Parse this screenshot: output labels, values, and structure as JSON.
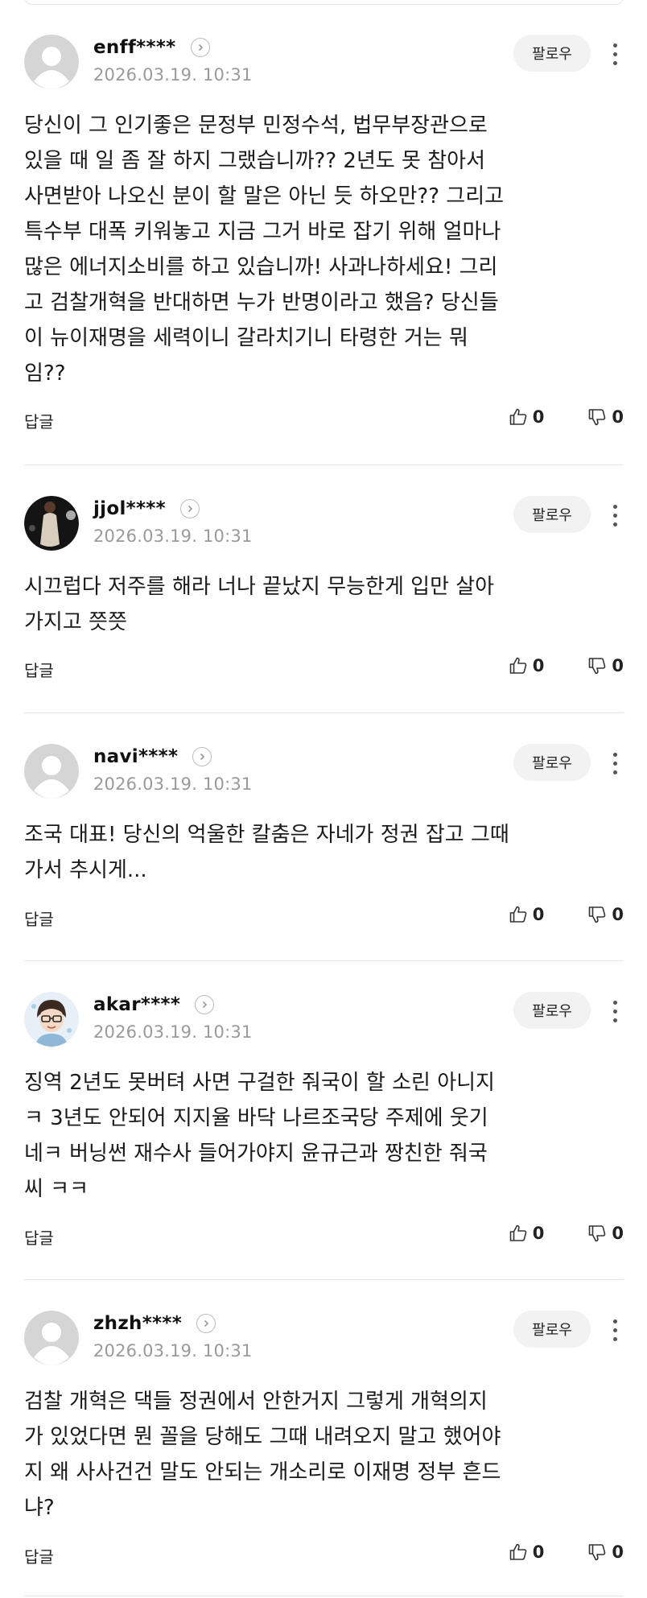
{
  "follow_label": "팔로우",
  "reply_label": "답글",
  "comments": [
    {
      "username": "enff****",
      "timestamp": "2026.03.19. 10:31",
      "avatar": "default-avatar",
      "text": "당신이 그 인기좋은 문정부 민정수석, 법무부장관으로\n있을 때 일 좀 잘 하지 그랬습니까?? 2년도 못 참아서\n사면받아 나오신 분이 할 말은 아닌 듯 하오만?? 그리고\n특수부 대폭 키워놓고 지금 그거 바로 잡기 위해 얼마나\n많은 에너지소비를 하고 있습니까! 사과나하세요! 그리\n고 검찰개혁을 반대하면 누가 반명이라고 했음? 당신들\n이 뉴이재명을 세력이니 갈라치기니 타령한 거는 뭐\n임??",
      "likes": "0",
      "dislikes": "0"
    },
    {
      "username": "jjol****",
      "timestamp": "2026.03.19. 10:31",
      "avatar": "photo-avatar",
      "text": "시끄럽다 저주를 해라 너나 끝났지 무능한게 입만 살아\n가지고 쯧쯧",
      "likes": "0",
      "dislikes": "0"
    },
    {
      "username": "navi****",
      "timestamp": "2026.03.19. 10:31",
      "avatar": "default-avatar",
      "text": "조국 대표! 당신의 억울한 칼춤은 자네가 정권 잡고 그때\n가서 추시게...",
      "likes": "0",
      "dislikes": "0"
    },
    {
      "username": "akar****",
      "timestamp": "2026.03.19. 10:31",
      "avatar": "cartoon-avatar",
      "text": "징역 2년도 못버텨 사면 구걸한 줘국이 할 소린 아니지\nㅋ 3년도 안되어 지지율 바닥 나르조국당 주제에 웃기\n네ㅋ 버닝썬 재수사 들어가야지 윤규근과 짱친한 줘국\n씨 ㅋㅋ",
      "likes": "0",
      "dislikes": "0"
    },
    {
      "username": "zhzh****",
      "timestamp": "2026.03.19. 10:31",
      "avatar": "default-avatar",
      "text": "검찰 개혁은 댁들 정권에서 안한거지 그렇게 개혁의지\n가 있었다면 뭔 꼴을 당해도 그때 내려오지 말고 했어야\n지 왜 사사건건 말도 안되는 개소리로 이재명 정부 흔드\n냐?",
      "likes": "0",
      "dislikes": "0"
    }
  ]
}
